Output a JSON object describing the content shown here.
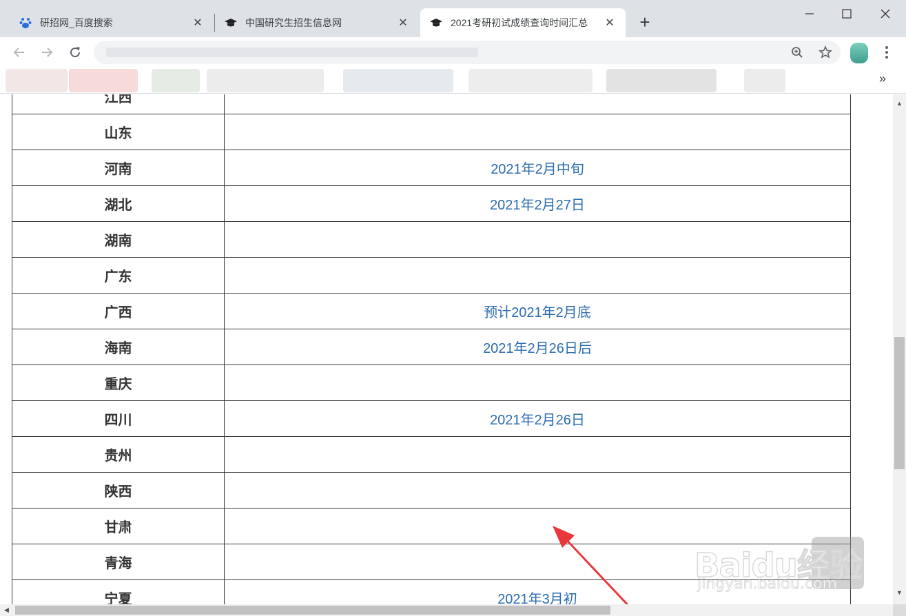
{
  "tabs": [
    {
      "title": "研招网_百度搜索",
      "icon": "baidu-paw-icon"
    },
    {
      "title": "中国研究生招生信息网",
      "icon": "graduation-cap-icon"
    },
    {
      "title": "2021考研初试成绩查询时间汇总",
      "icon": "graduation-cap-icon",
      "active": true
    }
  ],
  "new_tab_label": "+",
  "bookmarks_more": "»",
  "table": {
    "rows": [
      {
        "province": "江西",
        "date": ""
      },
      {
        "province": "山东",
        "date": ""
      },
      {
        "province": "河南",
        "date": "2021年2月中旬"
      },
      {
        "province": "湖北",
        "date": "2021年2月27日"
      },
      {
        "province": "湖南",
        "date": ""
      },
      {
        "province": "广东",
        "date": ""
      },
      {
        "province": "广西",
        "date": "预计2021年2月底"
      },
      {
        "province": "海南",
        "date": "2021年2月26日后"
      },
      {
        "province": "重庆",
        "date": ""
      },
      {
        "province": "四川",
        "date": "2021年2月26日"
      },
      {
        "province": "贵州",
        "date": ""
      },
      {
        "province": "陕西",
        "date": ""
      },
      {
        "province": "甘肃",
        "date": ""
      },
      {
        "province": "青海",
        "date": ""
      },
      {
        "province": "宁夏",
        "date": "2021年3月初"
      }
    ]
  },
  "watermark": {
    "logo": "Baidu经验",
    "url": "jingyan.baidu.com"
  },
  "colors": {
    "date_text": "#2b6cb0",
    "arrow": "#e8383d",
    "tabstrip": "#dee1e6"
  }
}
